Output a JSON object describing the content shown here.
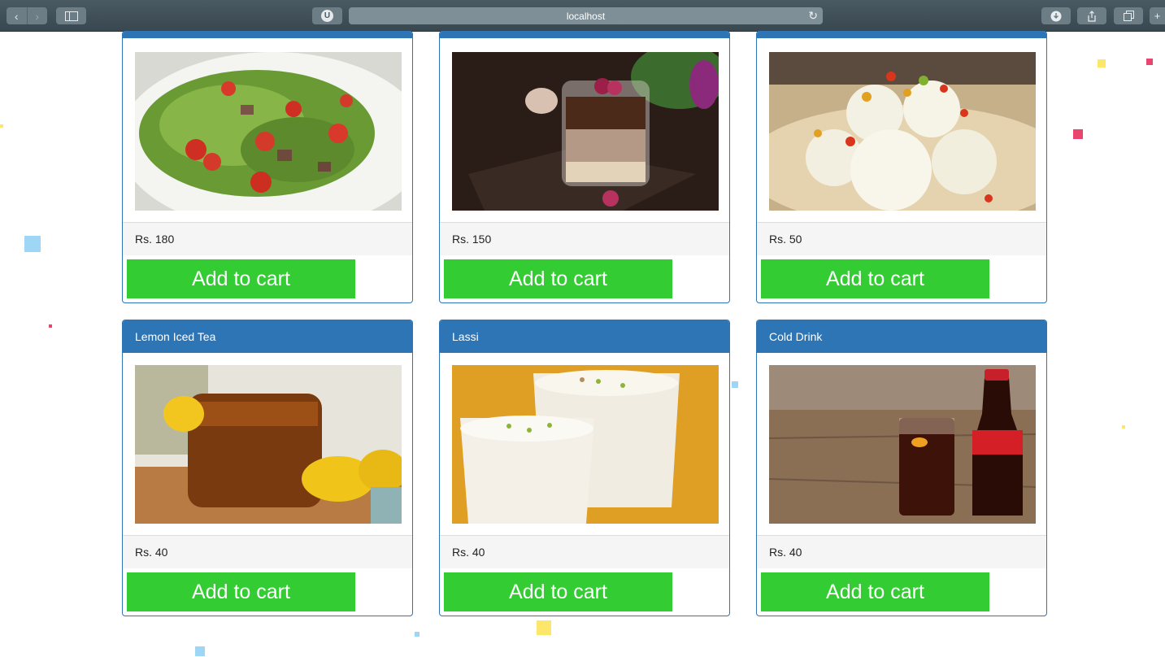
{
  "browser": {
    "url": "localhost",
    "ublock_label": "U"
  },
  "products": [
    {
      "name": "",
      "price": "Rs. 180",
      "button": "Add to cart",
      "image": "salad"
    },
    {
      "name": "",
      "price": "Rs. 150",
      "button": "Add to cart",
      "image": "chocolate-mousse"
    },
    {
      "name": "",
      "price": "Rs. 50",
      "button": "Add to cart",
      "image": "rasgulla"
    },
    {
      "name": "Lemon Iced Tea",
      "price": "Rs. 40",
      "button": "Add to cart",
      "image": "iced-tea"
    },
    {
      "name": "Lassi",
      "price": "Rs. 40",
      "button": "Add to cart",
      "image": "lassi"
    },
    {
      "name": "Cold Drink",
      "price": "Rs. 40",
      "button": "Add to cart",
      "image": "cola"
    }
  ],
  "colors": {
    "header": "#2e75b6",
    "button": "#33cc33",
    "price_bg": "#f5f5f5"
  }
}
